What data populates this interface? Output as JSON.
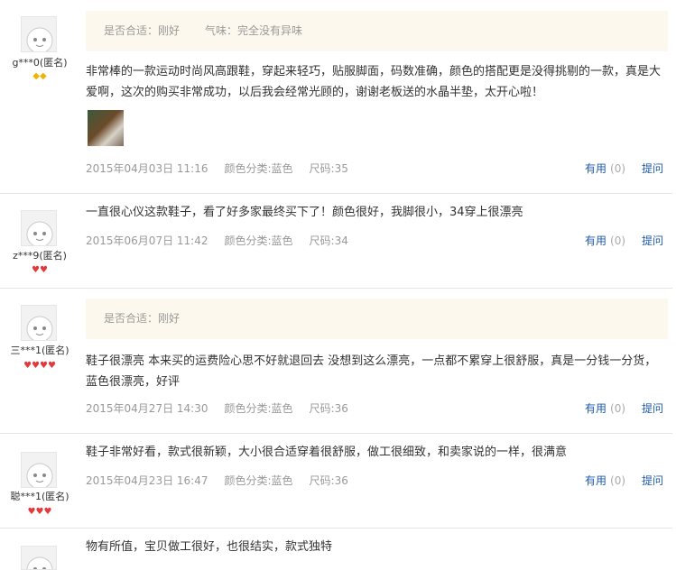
{
  "reviews": [
    {
      "user": "g***0(匿名)",
      "badge": "◆◆",
      "badge_color": "gold",
      "extra": {
        "fit": "是否合适：刚好",
        "smell": "气味：完全没有异味"
      },
      "content": "非常棒的一款运动时尚风高跟鞋，穿起来轻巧，贴服脚面，码数准确，颜色的搭配更是没得挑剔的一款，真是大爱啊，这次的购买非常成功，以后我会经常光顾的，谢谢老板送的水晶半垫，太开心啦！",
      "date": "2015年04月03日 11:16",
      "color": "颜色分类:蓝色",
      "size": "尺码:35",
      "useful": "有用",
      "useful_count": "(0)",
      "ask": "提问"
    },
    {
      "user": "z***9(匿名)",
      "badge": "♥♥",
      "badge_color": "red",
      "content": "一直很心仪这款鞋子，看了好多家最终买下了！颜色很好，我脚很小，34穿上很漂亮",
      "date": "2015年06月07日 11:42",
      "color": "颜色分类:蓝色",
      "size": "尺码:34",
      "useful": "有用",
      "useful_count": "(0)",
      "ask": "提问"
    },
    {
      "user": "三***1(匿名)",
      "badge": "♥♥♥♥",
      "badge_color": "red",
      "extra": {
        "fit": "是否合适：刚好"
      },
      "content": "鞋子很漂亮 本来买的运费险心思不好就退回去 没想到这么漂亮，一点都不累穿上很舒服，真是一分钱一分货，蓝色很漂亮，好评",
      "date": "2015年04月27日 14:30",
      "color": "颜色分类:蓝色",
      "size": "尺码:36",
      "useful": "有用",
      "useful_count": "(0)",
      "ask": "提问"
    },
    {
      "user": "聪***1(匿名)",
      "badge": "♥♥♥",
      "badge_color": "red",
      "content": "鞋子非常好看，款式很新颖，大小很合适穿着很舒服，做工很细致，和卖家说的一样，很满意",
      "date": "2015年04月23日 16:47",
      "color": "颜色分类:蓝色",
      "size": "尺码:36",
      "useful": "有用",
      "useful_count": "(0)",
      "ask": "提问"
    },
    {
      "content": "物有所值，宝贝做工很好，也很结实，款式独特"
    }
  ],
  "colors": {
    "link": "#1e5aa8",
    "muted": "#999999",
    "extra_bg": "#fdf8ee",
    "gold": "#f0b400",
    "red": "#e4393c"
  }
}
